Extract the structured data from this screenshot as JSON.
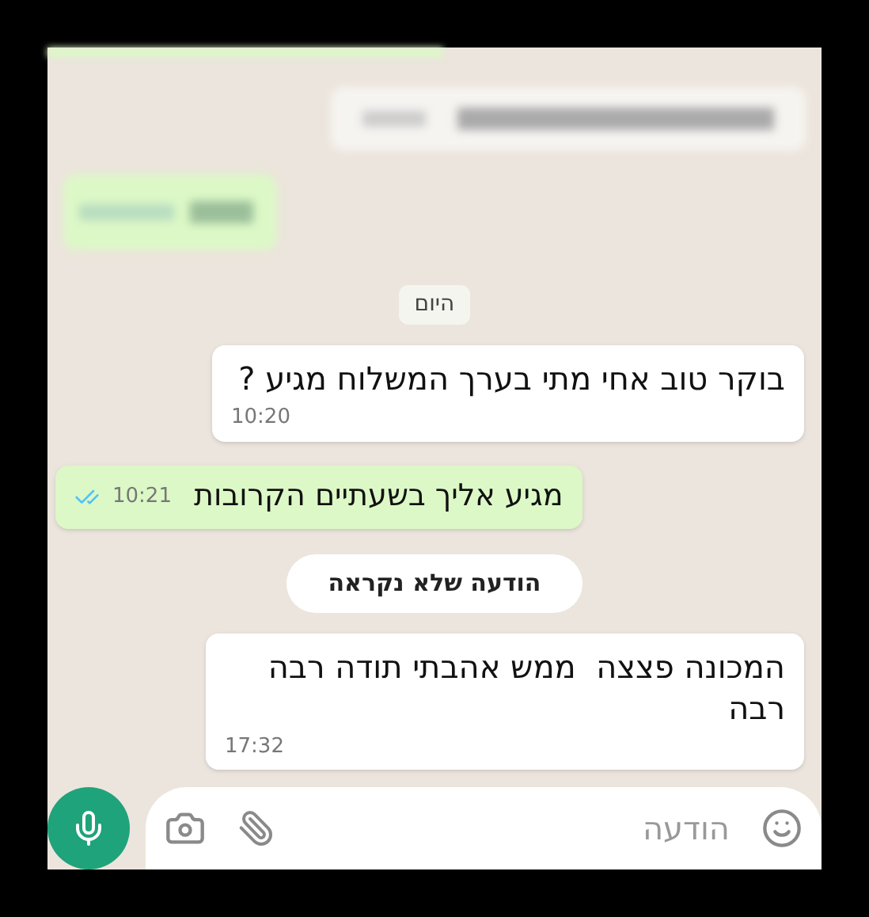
{
  "date_chip": "היום",
  "messages": [
    {
      "kind": "incoming",
      "text": "בוקר טוב אחי מתי בערך המשלוח מגיע ?",
      "time": "10:20"
    },
    {
      "kind": "outgoing",
      "text": "מגיע אליך בשעתיים הקרובות",
      "time": "10:21",
      "read": true
    }
  ],
  "unread_chip": "הודעה שלא נקראה",
  "later_messages": [
    {
      "kind": "incoming",
      "text": "המכונה פצצה  ממש אהבתי תודה רבה רבה",
      "time": "17:32"
    }
  ],
  "composer": {
    "placeholder": "הודעה"
  }
}
